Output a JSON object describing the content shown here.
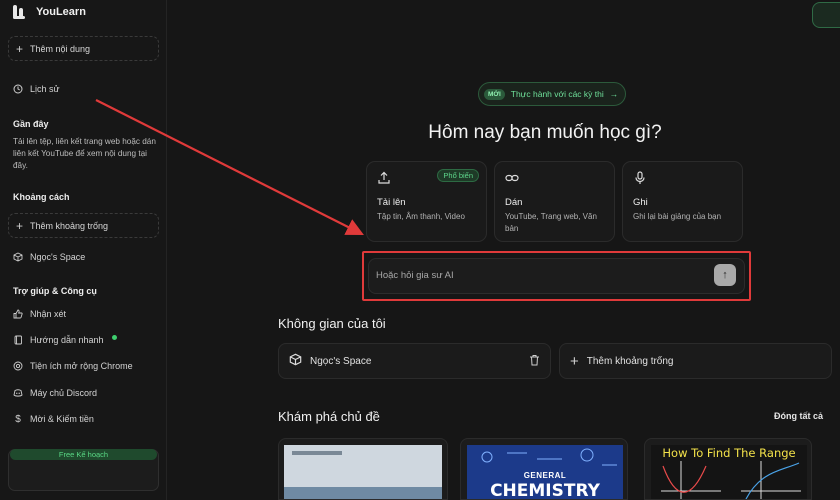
{
  "app": {
    "name": "YouLearn"
  },
  "sidebar": {
    "add_content": "Thêm nội dung",
    "history": "Lịch sử",
    "recent_heading": "Gần đây",
    "recent_desc": "Tải lên tệp, liên kết trang web hoặc dán liên kết YouTube để xem nội dung tại đây.",
    "spaces_heading": "Khoảng cách",
    "add_space": "Thêm khoảng trống",
    "space_item": "Ngọc's Space",
    "help_heading": "Trợ giúp & Công cụ",
    "help_items": [
      "Nhận xét",
      "Hướng dẫn nhanh",
      "Tiện ích mở rộng Chrome",
      "Máy chủ Discord",
      "Mời & Kiếm tiền"
    ],
    "plan": "Free Kế hoạch"
  },
  "main": {
    "promo_badge": "MỚI",
    "promo_text": "Thực hành với các kỳ thi",
    "promo_arrow": "→",
    "title": "Hôm nay bạn muốn học gì?",
    "cards": [
      {
        "icon": "upload-icon",
        "title": "Tải lên",
        "desc": "Tập tin, Âm thanh, Video",
        "badge": "Phổ biến"
      },
      {
        "icon": "link-icon",
        "title": "Dán",
        "desc": "YouTube, Trang web, Văn bản"
      },
      {
        "icon": "microphone-icon",
        "title": "Ghi",
        "desc": "Ghi lại bài giảng của bạn"
      }
    ],
    "ask_placeholder": "Hoặc hỏi gia sư AI",
    "my_spaces_title": "Không gian của tôi",
    "my_space_name": "Ngọc's Space",
    "add_space": "Thêm khoảng trống",
    "explore_title": "Khám phá chủ đề",
    "collapse_all": "Đóng tất cả",
    "thumbnails": [
      {
        "text": ""
      },
      {
        "top": "GENERAL",
        "text": "CHEMISTRY"
      },
      {
        "text": "How To Find The Range"
      }
    ]
  },
  "colors": {
    "accent_green": "#3ecf6e",
    "highlight_red": "#e03a3a",
    "background": "#161616"
  }
}
